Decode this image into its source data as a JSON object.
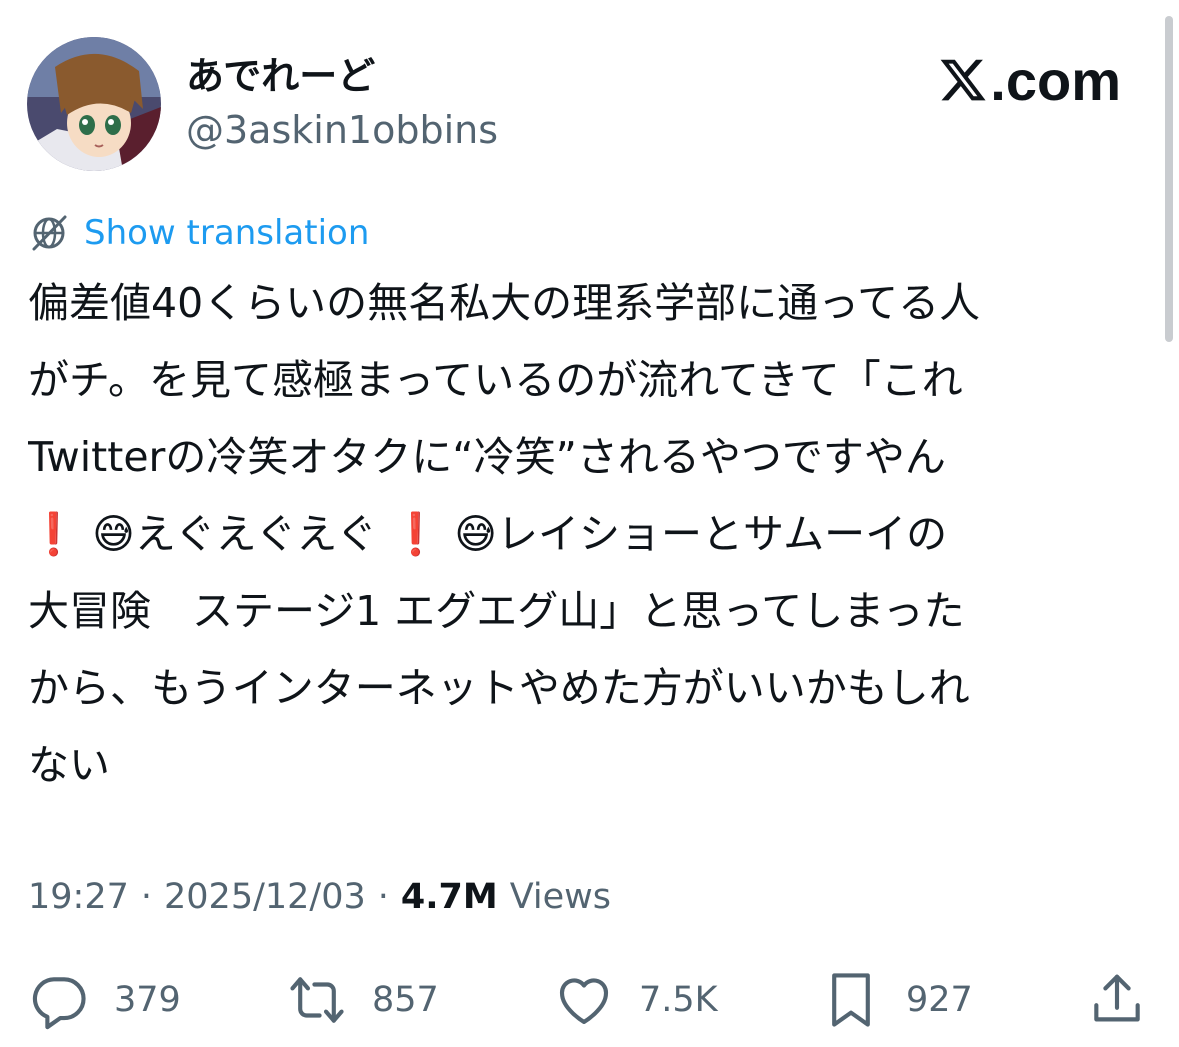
{
  "tweet": {
    "author": {
      "display_name": "あでれーど",
      "handle": "@3askin1obbins",
      "avatar_icon": "anime-avatar"
    },
    "brand": {
      "logo_icon": "x-logo-icon",
      "suffix": ".com"
    },
    "translate": {
      "icon": "globe-icon",
      "label": "Show translation",
      "color": "#1d9bf0"
    },
    "text_lines": [
      "偏差値40くらいの無名私大の理系学部に通ってる人",
      "がチ。を見て感極まっているのが流れてきて「これ",
      "Twitterの冷笑オタクに“冷笑”されるやつですやん",
      "❗ 😅えぐえぐえぐ ❗ 😅レイショーとサムーイの",
      "大冒険　ステージ1 エグエグ山」と思ってしまった",
      "から、もうインターネットやめた方がいいかもしれ",
      "ない"
    ],
    "meta": {
      "time": "19:27",
      "separator": "·",
      "date": "2025/12/03",
      "views_count": "4.7M",
      "views_label": "Views"
    },
    "actions": {
      "replies": {
        "icon": "reply-icon",
        "count": "379"
      },
      "reposts": {
        "icon": "repost-icon",
        "count": "857"
      },
      "likes": {
        "icon": "heart-icon",
        "count": "7.5K"
      },
      "bookmarks": {
        "icon": "bookmark-icon",
        "count": "927"
      },
      "share": {
        "icon": "share-icon"
      }
    },
    "colors": {
      "text": "#0f1419",
      "secondary": "#536471",
      "link": "#1d9bf0",
      "background": "#ffffff"
    }
  }
}
